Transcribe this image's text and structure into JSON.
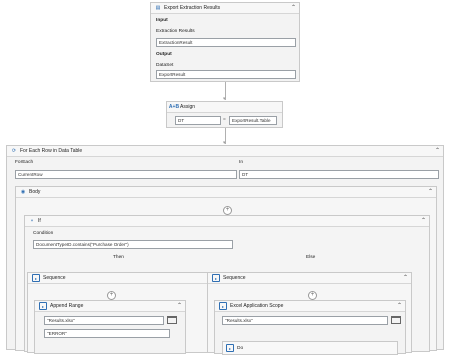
{
  "export": {
    "title": "Export Extraction Results",
    "input_heading": "Input",
    "input_label": "Extraction Results",
    "input_value": "ExtractionResult",
    "output_heading": "Output",
    "output_label": "DataSet",
    "output_value": "ExportResult"
  },
  "assign": {
    "title": "Assign",
    "left": "DT",
    "operator": "=",
    "right": "ExportResult.Table"
  },
  "foreach": {
    "title": "For Each Row in Data Table",
    "foreach_label": "ForEach",
    "foreach_value": "CurrentRow",
    "in_label": "In",
    "in_value": "DT"
  },
  "body": {
    "title": "Body"
  },
  "if": {
    "title": "If",
    "condition_label": "Condition",
    "condition_value": "DocumentTypeID.contains(\"Purchase Order\")",
    "then_label": "Then",
    "else_label": "Else"
  },
  "seq_then": {
    "title": "Sequence"
  },
  "seq_else": {
    "title": "Sequence"
  },
  "append": {
    "title": "Append Range",
    "file_value": "\"Results.xlsx\"",
    "sheet_value": "\"ERROR\""
  },
  "excel": {
    "title": "Excel Application Scope",
    "file_value": "\"Results.xlsx\"",
    "do_title": "Do"
  },
  "icons": [
    "export-icon",
    "assign-icon",
    "foreach-icon",
    "body-icon",
    "if-icon",
    "sequence-icon",
    "folder-icon",
    "collapse-icon"
  ]
}
